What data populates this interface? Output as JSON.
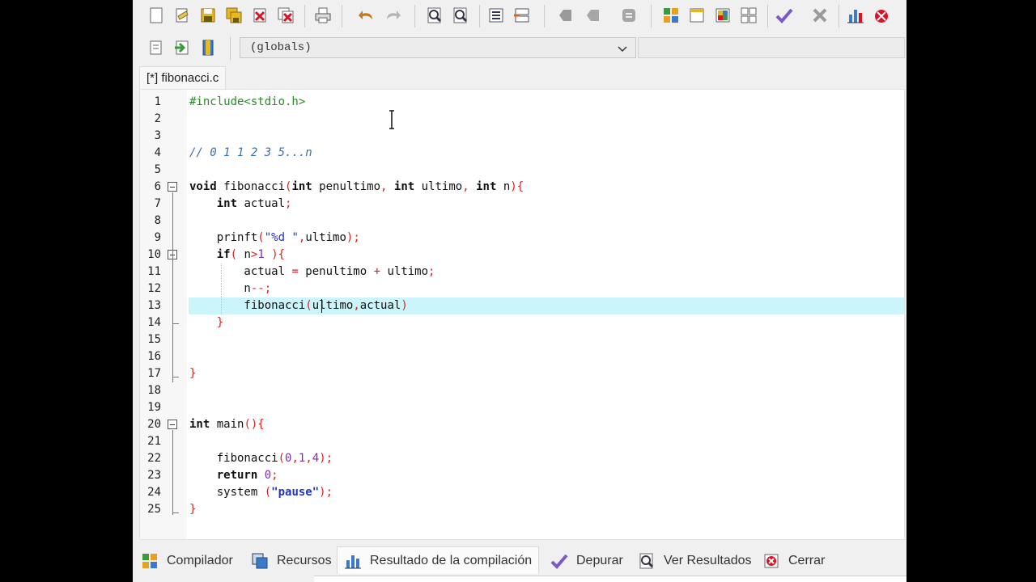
{
  "toolbar1": {
    "buttons": [
      "new-file-icon",
      "open-file-icon",
      "save-icon",
      "save-all-icon",
      "close-file-icon",
      "close-all-icon",
      "print-icon",
      "undo-icon",
      "redo-icon",
      "find-icon",
      "replace-icon",
      "indent-icon",
      "unindent-icon",
      "bookmark-back-icon",
      "bookmark-icon",
      "toggle-bookmark-icon",
      "grid-icon",
      "window-icon",
      "colors-icon",
      "tiles-icon",
      "check-icon",
      "close-icon",
      "chart-icon",
      "debug-icon"
    ]
  },
  "toolbar2": {
    "combo_value": "(globals)"
  },
  "tab": {
    "label": "[*] fibonacci.c"
  },
  "editor": {
    "lines": [
      {
        "n": "1",
        "parts": [
          [
            "pp",
            "#include<stdio.h>"
          ]
        ]
      },
      {
        "n": "2",
        "parts": []
      },
      {
        "n": "3",
        "parts": []
      },
      {
        "n": "4",
        "parts": [
          [
            "cm",
            "// 0 1 1 2 3 5...n"
          ]
        ]
      },
      {
        "n": "5",
        "parts": []
      },
      {
        "n": "6",
        "parts": [
          [
            "kw",
            "void"
          ],
          [
            "fn",
            " fibonacci"
          ],
          [
            "sym",
            "("
          ],
          [
            "kw",
            "int"
          ],
          [
            "fn",
            " penultimo"
          ],
          [
            "sym",
            ","
          ],
          [
            "fn",
            " "
          ],
          [
            "kw",
            "int"
          ],
          [
            "fn",
            " ultimo"
          ],
          [
            "sym",
            ","
          ],
          [
            "fn",
            " "
          ],
          [
            "kw",
            "int"
          ],
          [
            "fn",
            " n"
          ],
          [
            "sym",
            "){"
          ]
        ]
      },
      {
        "n": "7",
        "parts": [
          [
            "fn",
            "    "
          ],
          [
            "kw",
            "int"
          ],
          [
            "fn",
            " actual"
          ],
          [
            "sym",
            ";"
          ]
        ]
      },
      {
        "n": "8",
        "parts": []
      },
      {
        "n": "9",
        "parts": [
          [
            "fn",
            "    prinft"
          ],
          [
            "sym",
            "("
          ],
          [
            "str",
            "\"%d \""
          ],
          [
            "sym",
            ","
          ],
          [
            "fn",
            "ultimo"
          ],
          [
            "sym",
            ");"
          ]
        ]
      },
      {
        "n": "10",
        "parts": [
          [
            "fn",
            "    "
          ],
          [
            "kw",
            "if"
          ],
          [
            "sym",
            "("
          ],
          [
            "fn",
            " n"
          ],
          [
            "sym",
            ">"
          ],
          [
            "num",
            "1"
          ],
          [
            "fn",
            " "
          ],
          [
            "sym",
            "){"
          ]
        ]
      },
      {
        "n": "11",
        "parts": [
          [
            "fn",
            "        actual "
          ],
          [
            "sym",
            "="
          ],
          [
            "fn",
            " penultimo "
          ],
          [
            "sym",
            "+"
          ],
          [
            "fn",
            " ultimo"
          ],
          [
            "sym",
            ";"
          ]
        ]
      },
      {
        "n": "12",
        "parts": [
          [
            "fn",
            "        n"
          ],
          [
            "sym",
            "--;"
          ]
        ]
      },
      {
        "n": "13",
        "parts": [
          [
            "fn",
            "        fibonacci"
          ],
          [
            "sym",
            "("
          ],
          [
            "fn",
            "ultimo"
          ],
          [
            "sym",
            ","
          ],
          [
            "fn",
            "actual"
          ],
          [
            "sym",
            ")"
          ]
        ]
      },
      {
        "n": "14",
        "parts": [
          [
            "fn",
            "    "
          ],
          [
            "sym",
            "}"
          ]
        ]
      },
      {
        "n": "15",
        "parts": []
      },
      {
        "n": "16",
        "parts": []
      },
      {
        "n": "17",
        "parts": [
          [
            "sym",
            "}"
          ]
        ]
      },
      {
        "n": "18",
        "parts": []
      },
      {
        "n": "19",
        "parts": []
      },
      {
        "n": "20",
        "parts": [
          [
            "kw",
            "int"
          ],
          [
            "fn",
            " main"
          ],
          [
            "sym",
            "(){"
          ]
        ]
      },
      {
        "n": "21",
        "parts": []
      },
      {
        "n": "22",
        "parts": [
          [
            "fn",
            "    fibonacci"
          ],
          [
            "sym",
            "("
          ],
          [
            "num",
            "0"
          ],
          [
            "sym",
            ","
          ],
          [
            "num",
            "1"
          ],
          [
            "sym",
            ","
          ],
          [
            "num",
            "4"
          ],
          [
            "sym",
            ");"
          ]
        ]
      },
      {
        "n": "23",
        "parts": [
          [
            "fn",
            "    "
          ],
          [
            "kw",
            "return"
          ],
          [
            "fn",
            " "
          ],
          [
            "num",
            "0"
          ],
          [
            "sym",
            ";"
          ]
        ]
      },
      {
        "n": "24",
        "parts": [
          [
            "fn",
            "    system "
          ],
          [
            "sym",
            "("
          ],
          [
            "strb",
            "\"pause\""
          ],
          [
            "sym",
            ");"
          ]
        ]
      },
      {
        "n": "25",
        "parts": [
          [
            "sym",
            "}"
          ]
        ]
      }
    ],
    "highlighted_line": "13",
    "fold_markers": [
      "6",
      "10",
      "20"
    ]
  },
  "bottom_tabs": [
    {
      "label": "Compilador",
      "icon": "grid-icon"
    },
    {
      "label": "Recursos",
      "icon": "resources-icon"
    },
    {
      "label": "Resultado de la compilación",
      "icon": "chart-icon",
      "active": true
    },
    {
      "label": "Depurar",
      "icon": "check-icon"
    },
    {
      "label": "Ver Resultados",
      "icon": "find-results-icon"
    },
    {
      "label": "Cerrar",
      "icon": "close-panel-icon"
    }
  ],
  "colors": {
    "highlight": "#ccf4fb",
    "keyword": "#111111",
    "preprocessor": "#2a8a2a",
    "comment": "#3a6fb6",
    "symbol": "#dd2222",
    "number": "#7a2bb8",
    "string": "#2233cc"
  }
}
